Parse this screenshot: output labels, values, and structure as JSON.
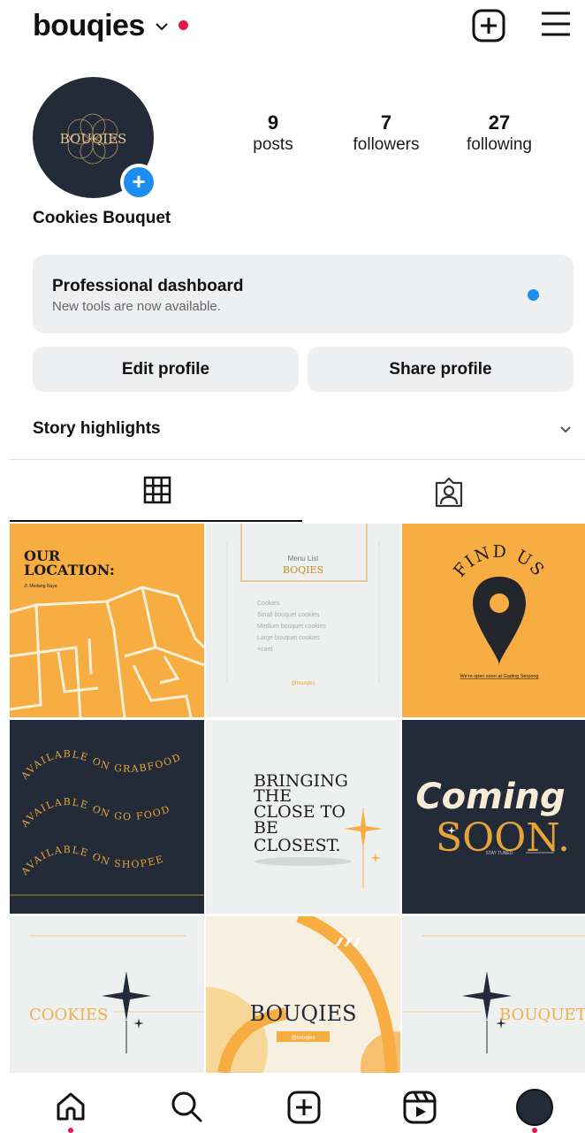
{
  "header": {
    "username": "bouqies",
    "dropdown_icon": "chevron-down-icon",
    "add_icon": "plus-square-icon",
    "menu_icon": "hamburger-menu-icon",
    "notification_color": "#e8174a"
  },
  "profile": {
    "avatar_text": "BOUQIES",
    "stats": [
      {
        "value": "9",
        "label": "posts"
      },
      {
        "value": "7",
        "label": "followers"
      },
      {
        "value": "27",
        "label": "following"
      }
    ],
    "display_name": "Cookies Bouquet"
  },
  "dashboard": {
    "title": "Professional dashboard",
    "subtitle": "New tools are now available.",
    "dot_color": "#1d8ef0"
  },
  "actions": {
    "edit_label": "Edit profile",
    "share_label": "Share profile"
  },
  "highlights": {
    "title": "Story highlights"
  },
  "tabs": [
    {
      "icon": "grid-icon",
      "active": true
    },
    {
      "icon": "tagged-person-icon",
      "active": false
    }
  ],
  "posts": [
    {
      "kind": "map",
      "title_line1": "OUR",
      "title_line2": "LOCATION:",
      "subtitle": "Jl. Medang Raya"
    },
    {
      "kind": "menu",
      "header_small": "Menu List",
      "header_big": "BOQIES",
      "items": [
        "Cookies",
        "Small bouquet cookies",
        "Medium bouquet cookies",
        "Large bouquet cookies",
        "+card"
      ],
      "handle": "@bouqies"
    },
    {
      "kind": "find",
      "arc_text": "FIND US",
      "footer": "We're open soon at Gading Serpong"
    },
    {
      "kind": "available",
      "lines": [
        [
          "AVAILABLE",
          "ON GRABFOOD"
        ],
        [
          "AVAILABLE",
          "ON GO FOOD"
        ],
        [
          "AVAILABLE",
          "ON SHOPEE"
        ]
      ]
    },
    {
      "kind": "bringing",
      "lines": [
        "BRINGING",
        "THE",
        "CLOSE TO",
        "BE",
        "CLOSEST."
      ]
    },
    {
      "kind": "coming",
      "line1": "Coming",
      "line2": "SOON.",
      "small": "STAY TUNED"
    },
    {
      "kind": "cookies",
      "text": "COOKIES"
    },
    {
      "kind": "bouqies",
      "text": "BOUQIES",
      "handle": "@bouqies"
    },
    {
      "kind": "bouquet",
      "text": "BOUQUET"
    }
  ],
  "nav": [
    {
      "icon": "home-icon"
    },
    {
      "icon": "search-icon"
    },
    {
      "icon": "plus-square-icon"
    },
    {
      "icon": "reels-icon"
    },
    {
      "icon": "profile-avatar-icon"
    }
  ],
  "colors": {
    "orange": "#f7ad42",
    "navy": "#232a38",
    "light_tile": "#eef0f0",
    "gold": "#e8a33a",
    "accent_blue": "#1d8ef0"
  }
}
